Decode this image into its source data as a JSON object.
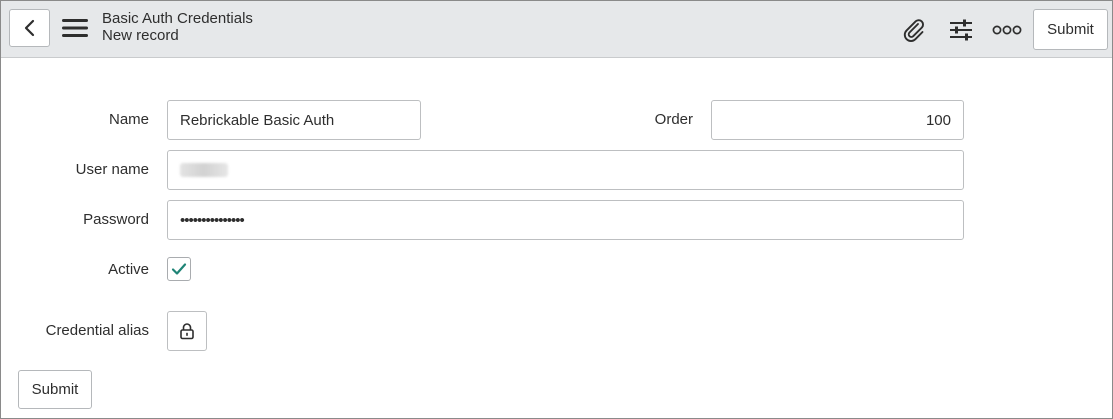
{
  "header": {
    "title": "Basic Auth Credentials",
    "subtitle": "New record",
    "submit_label": "Submit",
    "icons": [
      "back-arrow-icon",
      "hamburger-menu-icon",
      "paperclip-icon",
      "sliders-icon",
      "more-options-icon"
    ]
  },
  "form": {
    "name": {
      "label": "Name",
      "value": "Rebrickable Basic Auth"
    },
    "order": {
      "label": "Order",
      "value": "100"
    },
    "user_name": {
      "label": "User name",
      "value": ""
    },
    "password": {
      "label": "Password",
      "value": "•••••••••••••••"
    },
    "active": {
      "label": "Active",
      "checked": true
    },
    "credential_alias": {
      "label": "Credential alias",
      "icon": "lock-icon"
    }
  },
  "footer": {
    "submit_label": "Submit"
  },
  "colors": {
    "header_bg": "#e6e8ea",
    "check_color": "#1f8476",
    "border": "#bdbfc1"
  }
}
